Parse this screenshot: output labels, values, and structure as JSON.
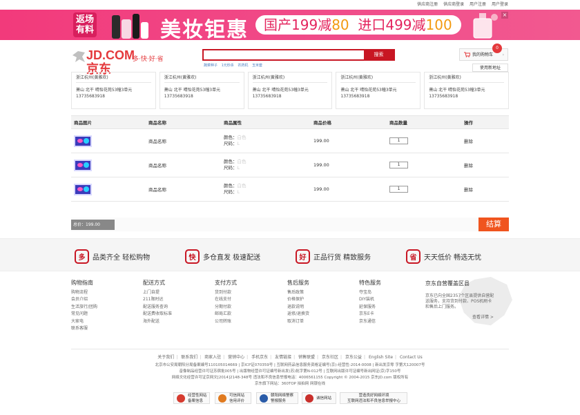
{
  "top_links": [
    "供应商注册",
    "供应商登录",
    "用户注册",
    "用户登录"
  ],
  "banner": {
    "tag_line1": "返场",
    "tag_line2": "有料",
    "headline": "美妆钜惠",
    "offer_a_prefix": "国产199减",
    "offer_a_value": "80",
    "offer_b_prefix": "进口499减",
    "offer_b_value": "100",
    "close": "×"
  },
  "header": {
    "logo_text": "JD.COM 京东",
    "slogan": "多·快·好·省",
    "search_button": "搜索",
    "search_placeholder": "",
    "hotwords": [
      "蔬菜种子",
      "1元秒杀",
      "农药机",
      "玉米套"
    ],
    "cart_label": "我的购物车",
    "cart_count": "0",
    "new_address": "使用新地址"
  },
  "addresses": [
    {
      "name": "浙江杭州(黄雅欢)",
      "detail": "萧山 北干 晴怡花苑53幢3单元",
      "phone": "13735683918"
    },
    {
      "name": "浙江杭州(黄雅欢)",
      "detail": "萧山 北干 晴怡花苑53幢3单元",
      "phone": "13735683918"
    },
    {
      "name": "浙江杭州(黄雅欢)",
      "detail": "萧山 北干 晴怡花苑53幢3单元",
      "phone": "13735683918"
    },
    {
      "name": "浙江杭州(黄雅欢)",
      "detail": "萧山 北干 晴怡花苑53幢3单元",
      "phone": "13735683918"
    },
    {
      "name": "浙江杭州(黄雅欢)",
      "detail": "萧山 北干 晴怡花苑53幢3单元",
      "phone": "13735683918"
    }
  ],
  "table": {
    "headers": [
      "商品图片",
      "商品名称",
      "商品属性",
      "商品价格",
      "商品数量",
      "操作"
    ],
    "rows": [
      {
        "name": "商品名称",
        "color_label": "颜色：",
        "color_value": "白色",
        "size_label": "尺码：",
        "size_value": "L",
        "price": "199.00",
        "qty": "1",
        "action": "删除"
      },
      {
        "name": "商品名称",
        "color_label": "颜色：",
        "color_value": "白色",
        "size_label": "尺码：",
        "size_value": "L",
        "price": "199.00",
        "qty": "1",
        "action": "删除"
      },
      {
        "name": "商品名称",
        "color_label": "颜色：",
        "color_value": "白色",
        "size_label": "尺码：",
        "size_value": "L",
        "price": "199.00",
        "qty": "1",
        "action": "删除"
      }
    ]
  },
  "summary": {
    "total": "总价：199.00",
    "checkout": "结算"
  },
  "promises": [
    {
      "badge": "多",
      "text": "品类齐全 轻松购物"
    },
    {
      "badge": "快",
      "text": "多仓直发 极速配送"
    },
    {
      "badge": "好",
      "text": "正品行货 精致服务"
    },
    {
      "badge": "省",
      "text": "天天低价 畅选无忧"
    }
  ],
  "footer_columns": [
    {
      "title": "购物指南",
      "items": [
        "购物流程",
        "会员介绍",
        "生活旅行/团购",
        "常见问题",
        "大家电",
        "联系客服"
      ]
    },
    {
      "title": "配送方式",
      "items": [
        "上门自提",
        "211限时达",
        "配送服务查询",
        "配送费收取标准",
        "海外配送"
      ]
    },
    {
      "title": "支付方式",
      "items": [
        "货到付款",
        "在线支付",
        "分期付款",
        "邮局汇款",
        "公司转账"
      ]
    },
    {
      "title": "售后服务",
      "items": [
        "售后政策",
        "价格保护",
        "退款说明",
        "返修/退换货",
        "取消订单"
      ]
    },
    {
      "title": "特色服务",
      "items": [
        "夺宝岛",
        "DIY装机",
        "延保服务",
        "京东E卡",
        "京东通信"
      ]
    }
  ],
  "coverage": {
    "title": "京东自营覆盖区县",
    "text": "京东已向全国2357个区县提供自营配送服务，支持货到付款、POS机刷卡和售后上门服务。",
    "more": "查看详情 >"
  },
  "footer_links": [
    "关于我们",
    "联系我们",
    "商家入驻",
    "营销中心",
    "手机京东",
    "友情链接",
    "销售联盟",
    "京东社区",
    "京东公益",
    "English Site",
    "Contact Us"
  ],
  "copyright_lines": [
    "北京市公安局朝阳分局备案编号110105014669 | 京ICP证070359号 | 互联网药品信息服务资格证编号(京)-经营性-2014-0008 | 新出发京零 字第大120007号",
    "音像制品经营许可证苏宿批005号 | 出版物经营许可证编号新出发(苏)批字第N-012号 | 互联网出版许可证编号新出网证(京)字150号",
    "网络文化经营许可证京网文[2014]2148-348号 违法和不良信息举报电话：4006561155 Copyright © 2004-2015 京东JD.com 版权所有",
    "京东旗下网站：360TOP 拍拍网 网银在线"
  ],
  "certs": [
    {
      "line1": "经营性网站",
      "line2": "备案信息",
      "color": "#d63b2f"
    },
    {
      "line1": "可信网站",
      "line2": "信用评价",
      "color": "#e07a1f"
    },
    {
      "line1": "朝阳网络警察",
      "line2": "警报服务",
      "color": "#2a5ca8"
    },
    {
      "line1": "诚信网站",
      "line2": "",
      "color": "#c9302c"
    },
    {
      "line1": "营造良好网络环境",
      "line2": "互联网违法和不良信息举报中心",
      "color": "#888888"
    }
  ],
  "colors": {
    "brand": "#c81623",
    "checkout": "#f0541e",
    "banner": "#f04d8a"
  }
}
